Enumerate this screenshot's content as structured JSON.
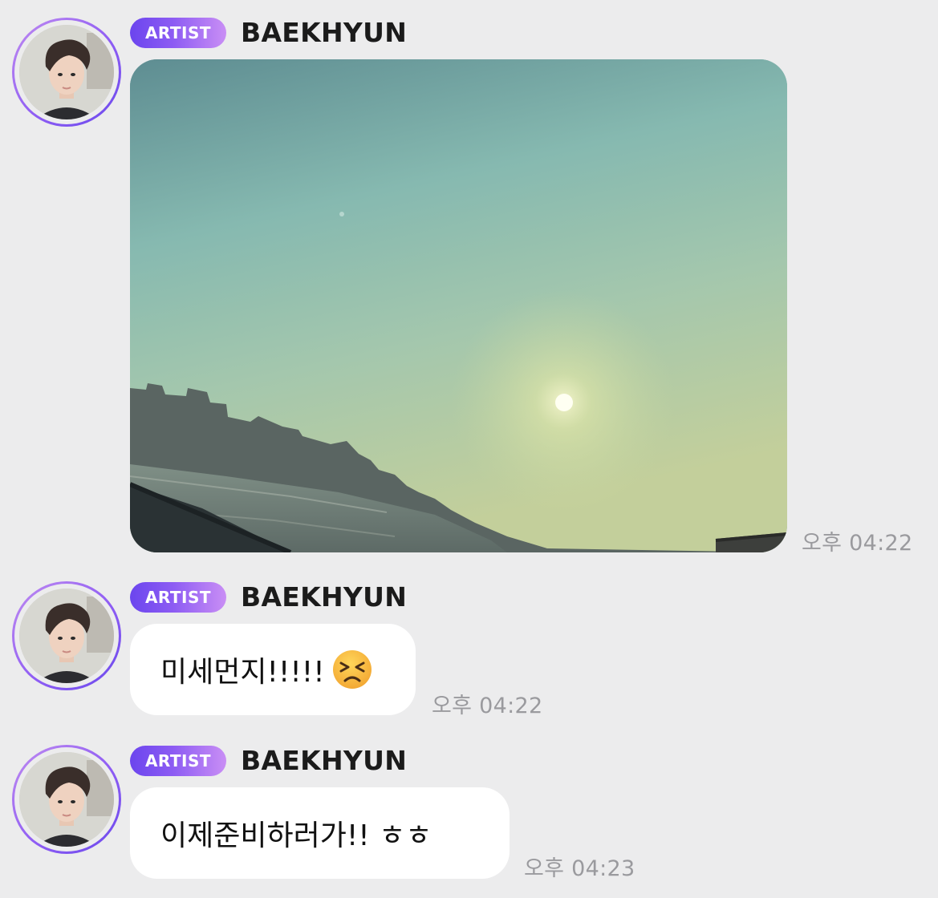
{
  "messages": [
    {
      "sender": {
        "badge": "ARTIST",
        "name": "BAEKHYUN"
      },
      "type": "image",
      "image_description": "hazy sky over river with sun and city skyline",
      "time": "오후 04:22"
    },
    {
      "sender": {
        "badge": "ARTIST",
        "name": "BAEKHYUN"
      },
      "type": "text",
      "text": "미세먼지!!!!!",
      "emoji": "persevering-face-emoji",
      "time": "오후 04:22"
    },
    {
      "sender": {
        "badge": "ARTIST",
        "name": "BAEKHYUN"
      },
      "type": "text",
      "text": "이제준비하러가!! ㅎㅎ",
      "time": "오후 04:23"
    }
  ],
  "colors": {
    "background": "#ececed",
    "badge_gradient_start": "#6b45ee",
    "badge_gradient_end": "#c98ef5",
    "avatar_ring": "#8f5df4",
    "bubble": "#ffffff",
    "timestamp": "#9a9a9e"
  }
}
